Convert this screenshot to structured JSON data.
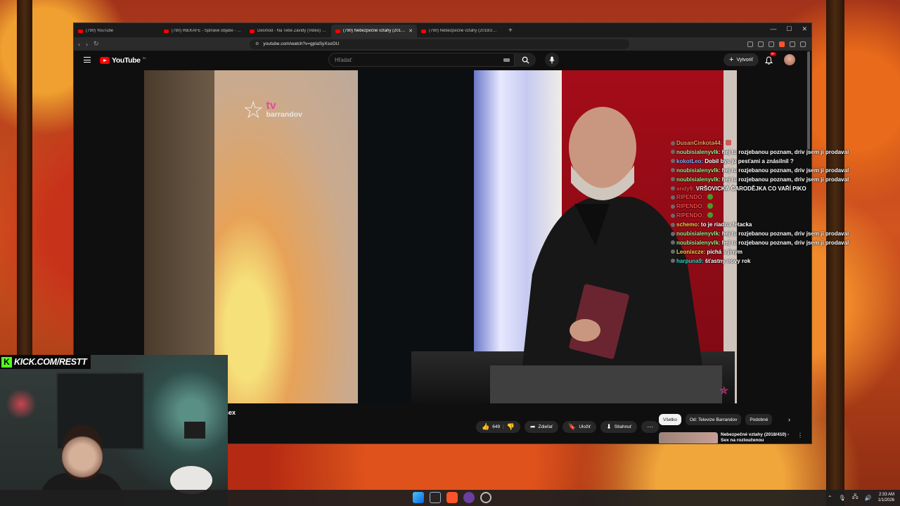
{
  "tabs": [
    {
      "label": "(790) YouTube",
      "active": false
    },
    {
      "label": "(790) INEKAFE - Špinavé objatie - YouTube",
      "active": false
    },
    {
      "label": "Desmod - Na Tebe Zavidy (Video) - YouTube",
      "active": false
    },
    {
      "label": "(790) Nebezpečné vztahy (2019/258)",
      "active": true
    },
    {
      "label": "(790) Nebezpečné vztahy (2019/258)",
      "active": false
    }
  ],
  "address": {
    "url": "youtube.com/watch?v=gpIaSyXsoOU"
  },
  "youtube": {
    "logo_text": "YouTube",
    "region": "SK",
    "search_placeholder": "Hľadať",
    "create_label": "Vytvoriť",
    "notif_count": "9+"
  },
  "video": {
    "channel_logo_tv": "tv",
    "channel_logo_name": "barrandov",
    "title_fragment": "sex"
  },
  "chat": [
    {
      "user": "DusanCinkota44:",
      "text": "",
      "user_color": "#f0a060",
      "emote": "red"
    },
    {
      "user": "noubisialenyvlk:",
      "text": "hej tu rozjebanou poznam, driv jsem ji prodaval",
      "user_color": "#9ef08a"
    },
    {
      "user": "kokotLeo:",
      "text": "Dobil bys ju pesťami a znásilnil ?",
      "user_color": "#7fb4ff"
    },
    {
      "user": "noubisialenyvlk:",
      "text": "hej tu rozjebanou poznam, driv jsem ji prodaval",
      "user_color": "#9ef08a"
    },
    {
      "user": "noubisialenyvlk:",
      "text": "hej tu rozjebanou poznam, driv jsem ji prodaval",
      "user_color": "#9ef08a"
    },
    {
      "user": "andy9:",
      "text": "VRŠOVICKÁ ČARODĚJKA CO VAŘÍ PIKO",
      "user_color": "#ff4a4a"
    },
    {
      "user": "RIPENDO:",
      "text": "",
      "user_color": "#ff4a4a",
      "emote": "green"
    },
    {
      "user": "RIPENDO:",
      "text": "",
      "user_color": "#ff4a4a",
      "emote": "green"
    },
    {
      "user": "RIPENDO:",
      "text": "",
      "user_color": "#ff4a4a",
      "emote": "green"
    },
    {
      "user": "schemo:",
      "text": "to je riadna fetacka",
      "user_color": "#ffd23a"
    },
    {
      "user": "noubisialenyvlk:",
      "text": "hej tu rozjebanou poznam, driv jsem ji prodaval",
      "user_color": "#9ef08a"
    },
    {
      "user": "noubisialenyvlk:",
      "text": "hej tu rozjebanou poznam, driv jsem ji prodaval",
      "user_color": "#9ef08a"
    },
    {
      "user": "Leonixcze:",
      "text": "pichá s jiným",
      "user_color": "#ffd23a"
    },
    {
      "user": "harpuna9:",
      "text": "šťastny novy rok",
      "user_color": "#39d6c8"
    }
  ],
  "actions": {
    "likes": "649",
    "share": "Zdieľať",
    "save": "Uložiť",
    "download": "Stiahnuť"
  },
  "chips": [
    "Všetko",
    "Od: Televize Barrandov",
    "Podobné"
  ],
  "recommendation": {
    "title": "Nebezpečné vztahy (2018/410) - Sex na rozloučenou"
  },
  "overlay": {
    "kick_text": "KICK.COM/RESTT"
  },
  "taskbar": {
    "time": "2:33 AM",
    "date": "1/1/2026"
  },
  "colors": {
    "youtube_red": "#ff0000",
    "kick_green": "#53fc18",
    "tv_barrandov_pink": "#e34aa0"
  }
}
